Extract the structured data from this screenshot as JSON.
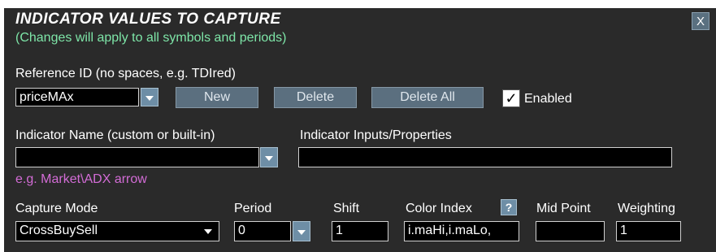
{
  "panel": {
    "title": "INDICATOR VALUES TO CAPTURE",
    "subtitle": "(Changes will apply to all symbols and periods)",
    "close_label": "X"
  },
  "reference": {
    "label": "Reference ID (no spaces, e.g. TDIred)",
    "value": "priceMAx",
    "new_label": "New",
    "delete_label": "Delete",
    "delete_all_label": "Delete All",
    "enabled_checked_glyph": "✓",
    "enabled_label": "Enabled"
  },
  "indicator": {
    "name_label": "Indicator Name (custom or built-in)",
    "name_value": "",
    "inputs_label": "Indicator Inputs/Properties",
    "inputs_value": "",
    "hint": "e.g. Market\\ADX arrow"
  },
  "capture": {
    "mode_label": "Capture Mode",
    "mode_value": "CrossBuySell",
    "period_label": "Period",
    "period_value": "0",
    "shift_label": "Shift",
    "shift_value": "1",
    "color_index_label": "Color Index",
    "color_index_help": "?",
    "color_index_value": "i.maHi,i.maLo,",
    "mid_point_label": "Mid Point",
    "mid_point_value": "",
    "weighting_label": "Weighting",
    "weighting_value": "1"
  },
  "colors": {
    "panel_bg": "#2a2a2a",
    "subtitle": "#7ee6a8",
    "hint": "#d36cd6",
    "button": "#5b6f7f"
  }
}
